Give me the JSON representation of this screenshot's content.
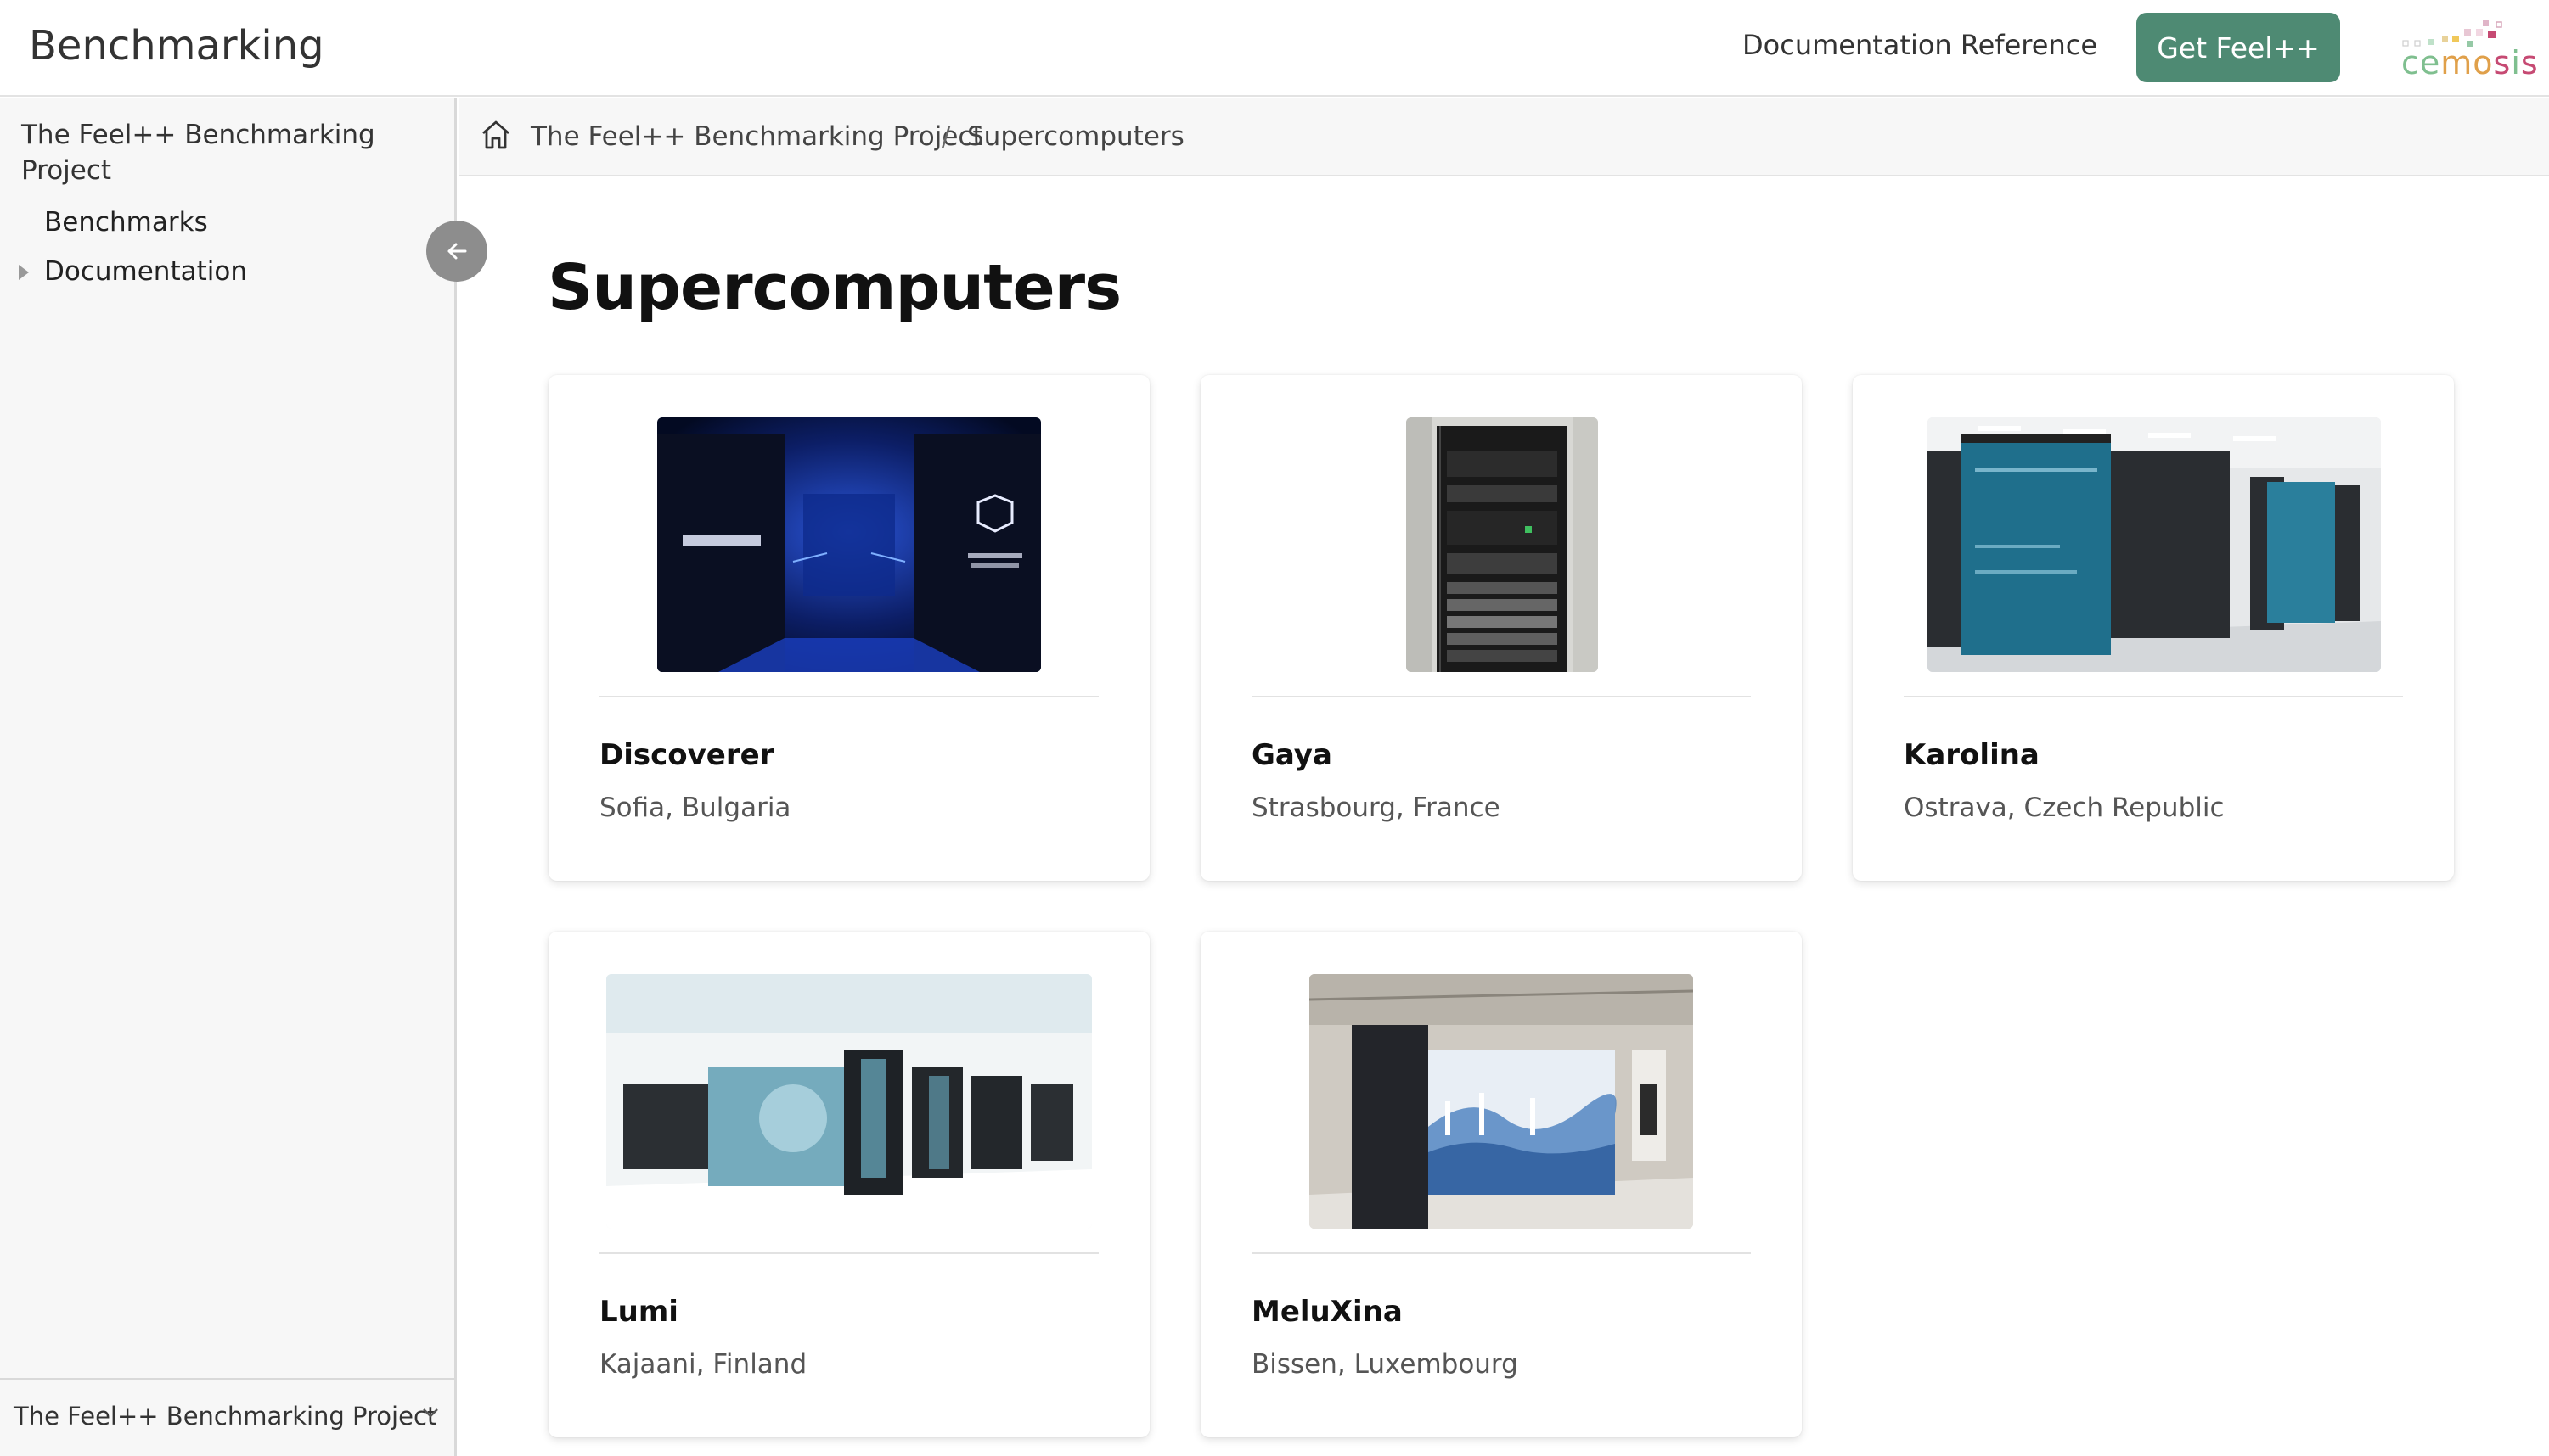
{
  "header": {
    "brand": "Benchmarking",
    "doc_link": "Documentation Reference",
    "cta_label": "Get Feel++",
    "logo_text": "cemosis",
    "accent_color": "#4e8a73"
  },
  "sidebar": {
    "root_label": "The Feel++ Benchmarking Project",
    "items": [
      {
        "label": "Benchmarks"
      },
      {
        "label": "Documentation"
      }
    ],
    "footer_label": "The Feel++ Benchmarking Project",
    "collapse_icon": "arrow-left-icon",
    "footer_icon": "chevron-down-icon"
  },
  "breadcrumb": {
    "items": [
      "The Feel++ Benchmarking Project",
      "Supercomputers"
    ],
    "separator": "/",
    "home_icon": "home-icon"
  },
  "page": {
    "title": "Supercomputers"
  },
  "cards": [
    {
      "name": "Discoverer",
      "location": "Sofia, Bulgaria"
    },
    {
      "name": "Gaya",
      "location": "Strasbourg, France"
    },
    {
      "name": "Karolina",
      "location": "Ostrava, Czech Republic"
    },
    {
      "name": "Lumi",
      "location": "Kajaani, Finland"
    },
    {
      "name": "MeluXina",
      "location": "Bissen, Luxembourg"
    }
  ]
}
